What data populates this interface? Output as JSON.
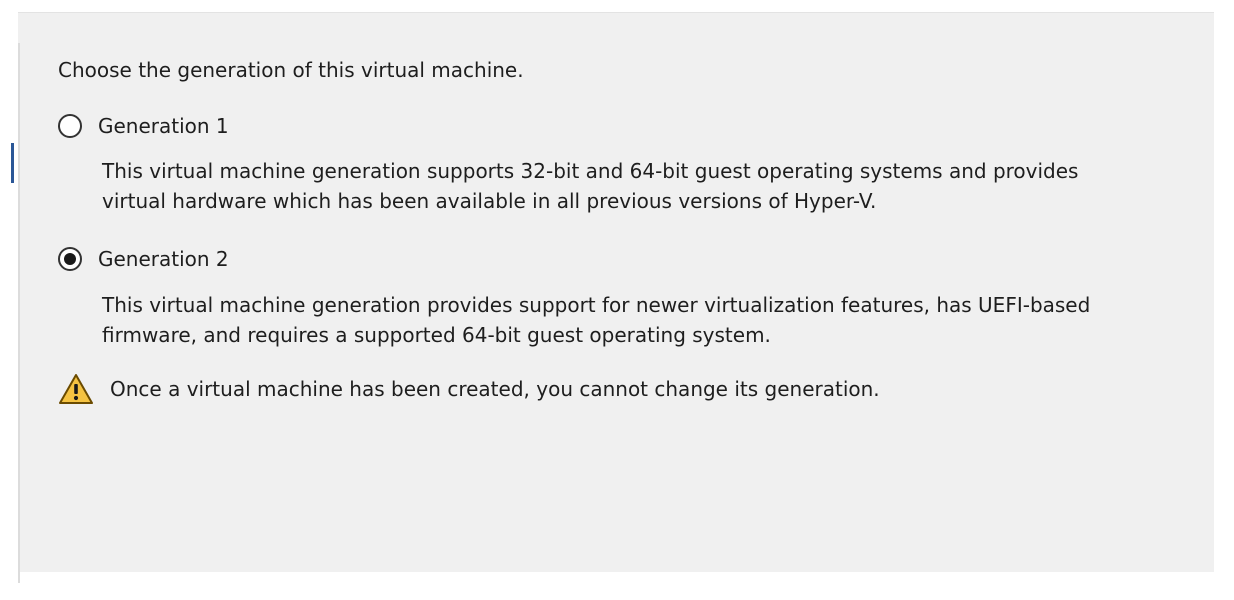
{
  "wizard": {
    "instruction": "Choose the generation of this virtual machine.",
    "options": [
      {
        "label": "Generation 1",
        "selected": false,
        "description_line1": "This virtual machine generation supports 32-bit and 64-bit guest operating systems and provides",
        "description_line2": "virtual hardware which has been available in all previous versions of Hyper-V."
      },
      {
        "label": "Generation 2",
        "selected": true,
        "description_line1": "This virtual machine generation provides support for newer virtualization features, has UEFI-based",
        "description_line2": "firmware, and requires a supported 64-bit guest operating system."
      }
    ],
    "warning": {
      "icon": "warning-icon",
      "text": "Once a virtual machine has been created, you cannot change its generation."
    }
  },
  "colors": {
    "panel_background": "#f0f0f0",
    "warning_fill": "#f5c342",
    "accent": "#2b5797"
  }
}
